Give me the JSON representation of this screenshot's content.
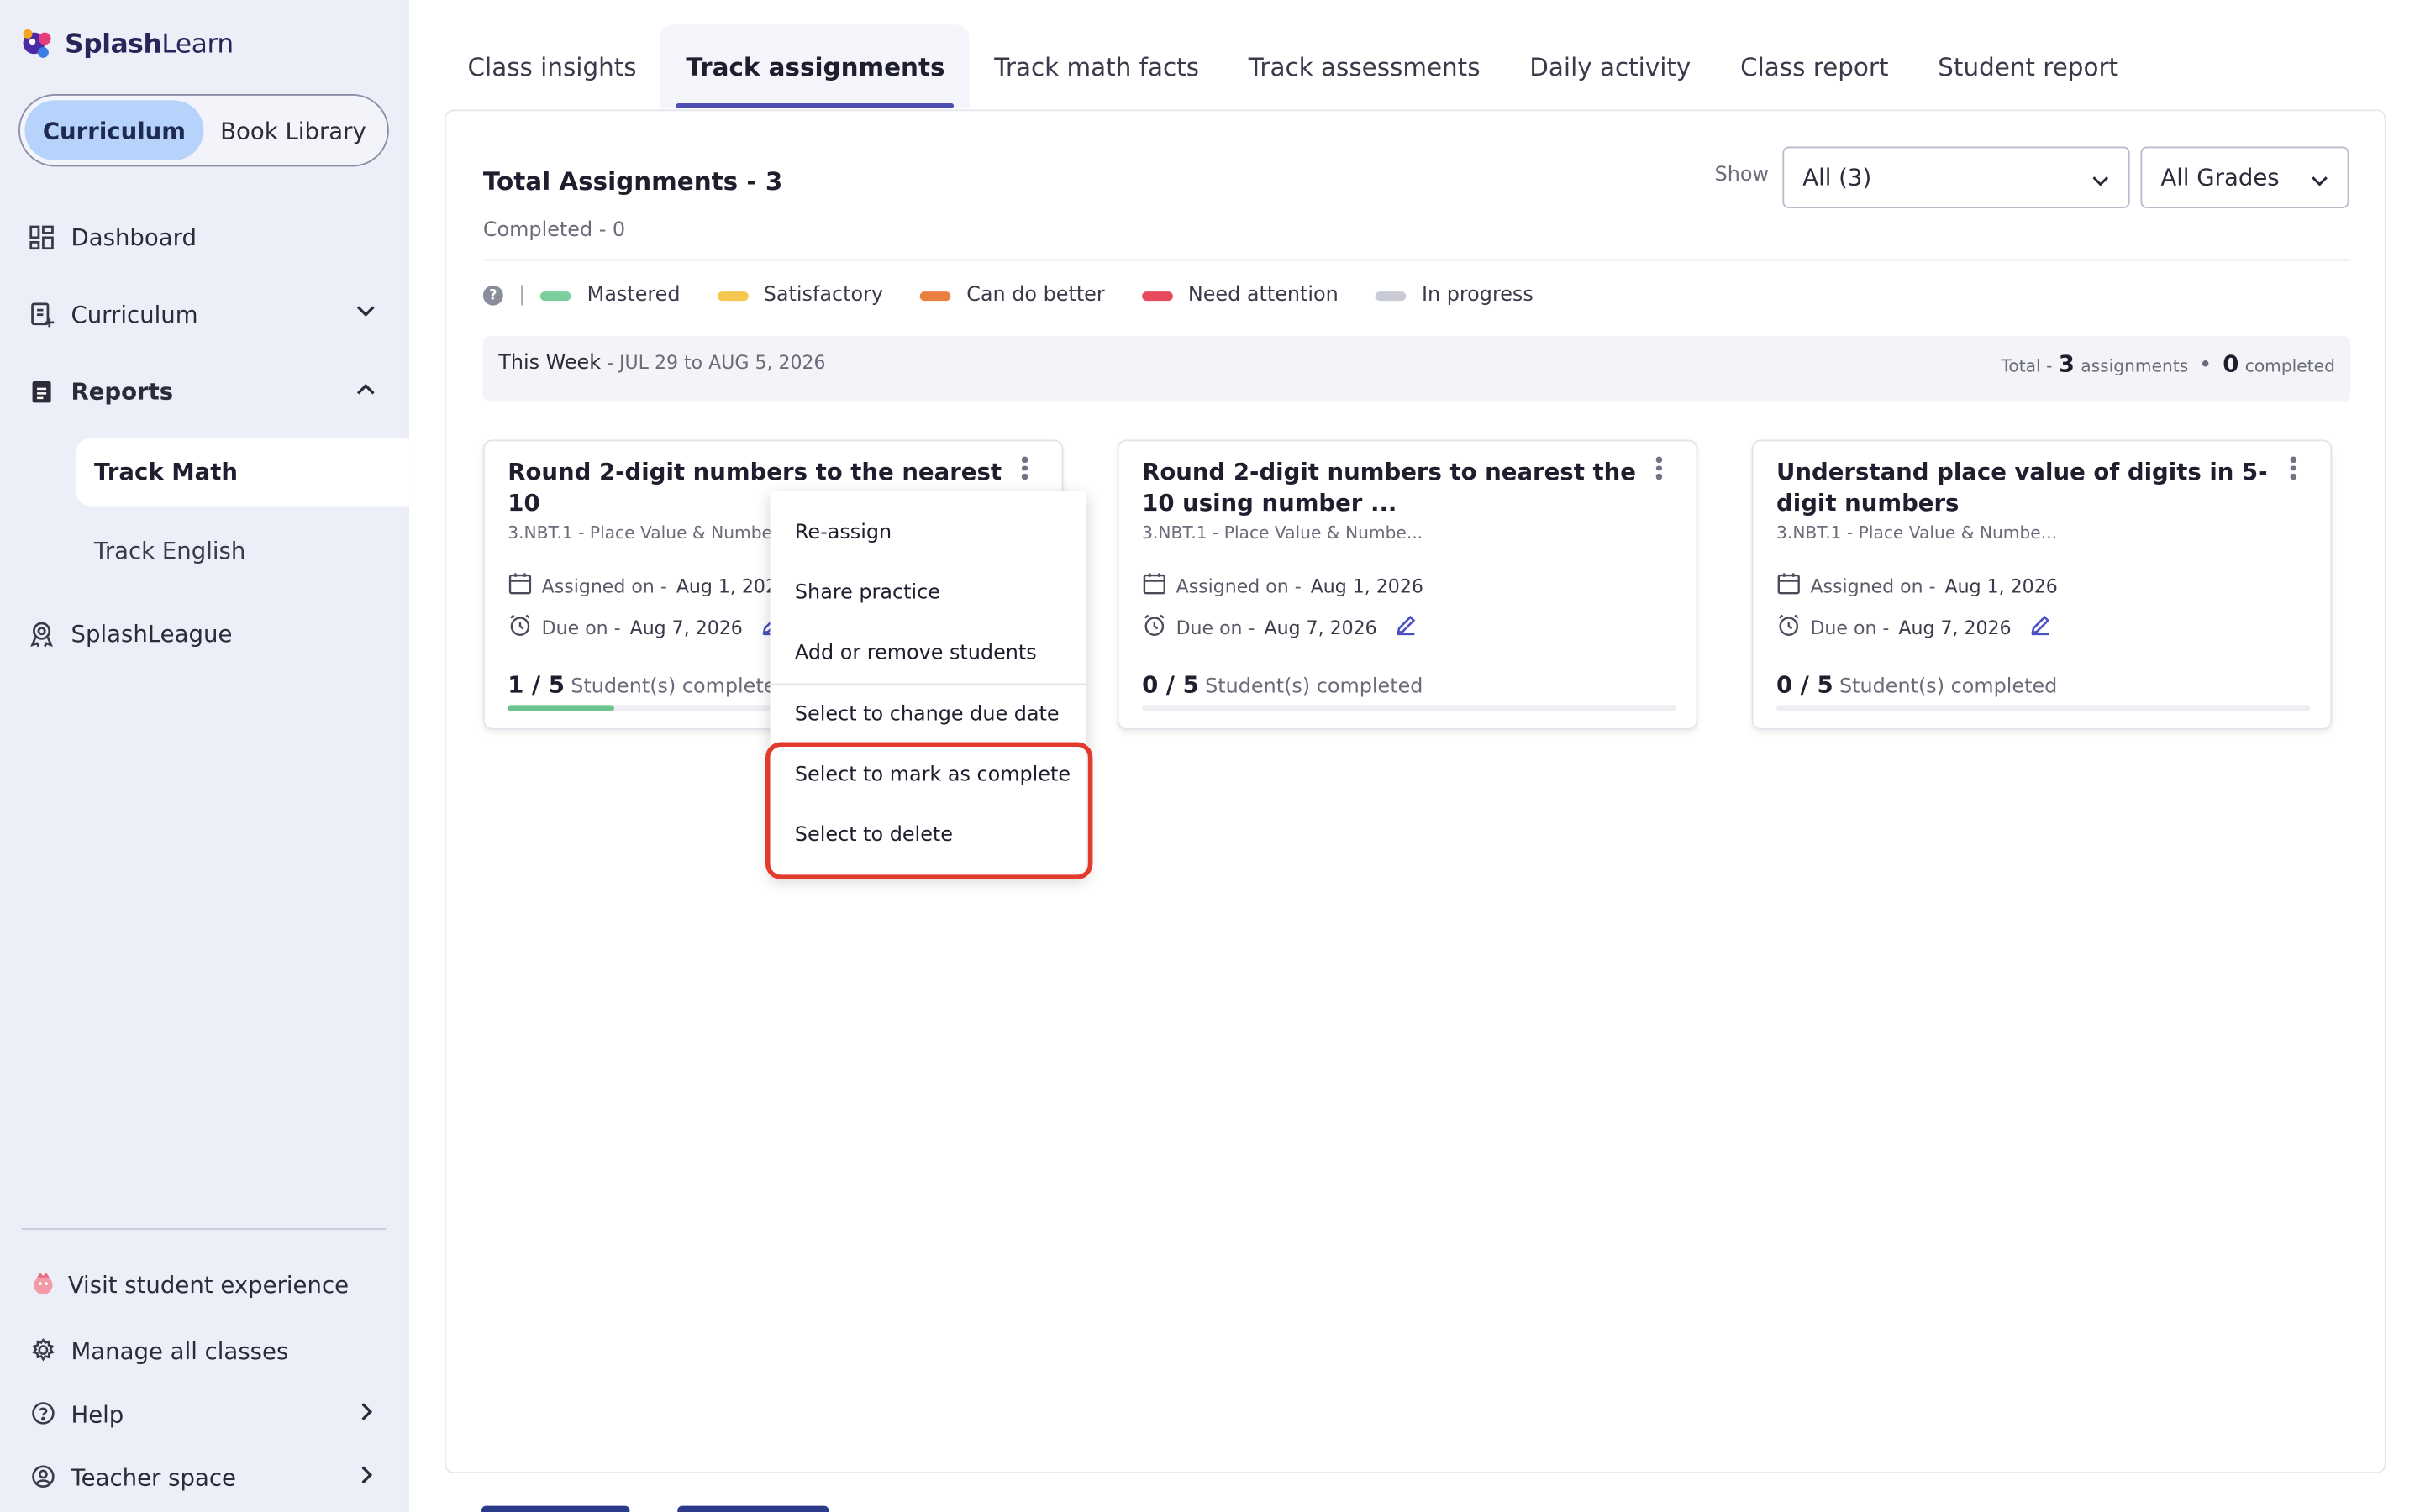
{
  "brand": {
    "name_bold": "Splash",
    "name_light": "Learn"
  },
  "sidebar": {
    "toggle": {
      "curriculum": "Curriculum",
      "library": "Book Library"
    },
    "items": [
      {
        "label": "Dashboard",
        "icon": "dashboard-icon"
      },
      {
        "label": "Curriculum",
        "icon": "curriculum-icon"
      },
      {
        "label": "Reports",
        "icon": "reports-icon"
      },
      {
        "label": "SplashLeague",
        "icon": "league-icon"
      }
    ],
    "reports_sub": {
      "track_math": "Track Math",
      "track_english": "Track English"
    },
    "footer": {
      "visit": "Visit student experience",
      "manage": "Manage all classes",
      "help": "Help",
      "teacher": "Teacher space"
    }
  },
  "tabs": [
    "Class insights",
    "Track assignments",
    "Track math facts",
    "Track assessments",
    "Daily activity",
    "Class report",
    "Student report"
  ],
  "active_tab": "Track assignments",
  "summary": {
    "title": "Total Assignments - 3",
    "completed": "Completed - 0",
    "show_label": "Show",
    "filter_value": "All (3)",
    "grade_value": "All Grades"
  },
  "legend": [
    {
      "label": "Mastered",
      "color": "#7ccf9c"
    },
    {
      "label": "Satisfactory",
      "color": "#f4c74f"
    },
    {
      "label": "Can do better",
      "color": "#e9803f"
    },
    {
      "label": "Need attention",
      "color": "#e5495a"
    },
    {
      "label": "In progress",
      "color": "#c9cbd6"
    }
  ],
  "week": {
    "label": "This Week",
    "range": " - JUL 29 to AUG 5, 2026",
    "total_prefix": "Total -",
    "total_count": "3",
    "total_suffix": "assignments",
    "completed_count": "0",
    "completed_suffix": "completed"
  },
  "cards": [
    {
      "title": "Round 2-digit numbers to the nearest 10",
      "standard": "3.NBT.1 - Place Value & Numbe...",
      "assigned_label": "Assigned on -",
      "assigned_date": "Aug 1, 2026",
      "due_label": "Due on -",
      "due_date": "Aug 7, 2026",
      "done": "1 / 5",
      "done_label": "Student(s) completed",
      "progress": 0.2
    },
    {
      "title": "Round 2-digit numbers to nearest the 10 using number ...",
      "standard": "3.NBT.1 - Place Value & Numbe...",
      "assigned_label": "Assigned on -",
      "assigned_date": "Aug 1, 2026",
      "due_label": "Due on -",
      "due_date": "Aug 7, 2026",
      "done": "0 / 5",
      "done_label": "Student(s) completed",
      "progress": 0
    },
    {
      "title": "Understand place value of digits in 5-digit numbers",
      "standard": "3.NBT.1 - Place Value & Numbe...",
      "assigned_label": "Assigned on -",
      "assigned_date": "Aug 1, 2026",
      "due_label": "Due on -",
      "due_date": "Aug 7, 2026",
      "done": "0 / 5",
      "done_label": "Student(s) completed",
      "progress": 0
    }
  ],
  "menu": {
    "items": [
      "Re-assign",
      "Share practice",
      "Add or remove students",
      "Select to change due date",
      "Select to mark as complete",
      "Select to delete"
    ],
    "highlight_color": "#e23b2e"
  }
}
